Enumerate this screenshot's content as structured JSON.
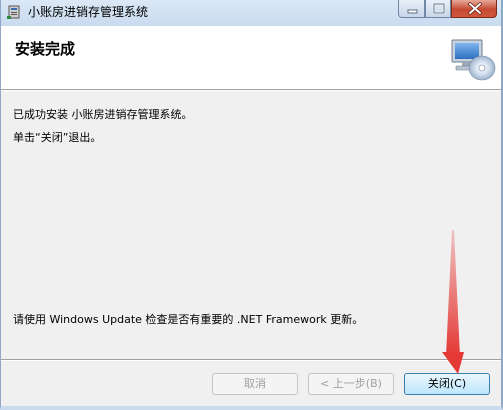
{
  "window": {
    "title": "小账房进销存管理系统",
    "icon": "installer-app-icon",
    "controls": [
      "minimize-icon",
      "maximize-icon",
      "close-icon"
    ]
  },
  "header": {
    "title": "安装完成",
    "icon": "computer-cd-icon"
  },
  "body": {
    "message_success": "已成功安装 小账房进销存管理系统。",
    "message_exit": "单击“关闭”退出。",
    "message_update": "请使用 Windows Update 检查是否有重要的 .NET Framework 更新。"
  },
  "footer": {
    "cancel_label": "取消",
    "back_label": "< 上一步(B)",
    "close_label": "关闭(C)"
  },
  "annotation": {
    "arrow_color": "#e53935"
  }
}
